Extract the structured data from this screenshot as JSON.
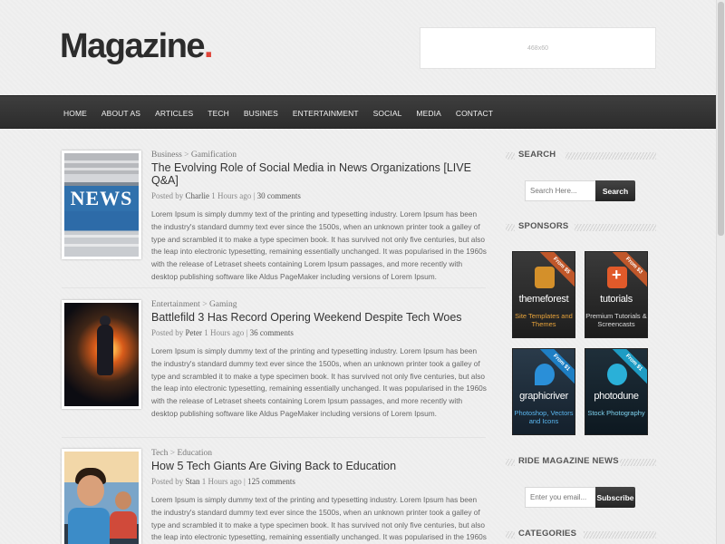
{
  "header": {
    "logo_text": "Magazine",
    "logo_dot": ".",
    "ad_label": "468x60"
  },
  "nav": {
    "items": [
      "HOME",
      "ABOUT AS",
      "ARTICLES",
      "TECH",
      "BUSINES",
      "ENTERTAINMENT",
      "SOCIAL",
      "MEDIA",
      "CONTACT"
    ]
  },
  "posts": [
    {
      "category": "Business",
      "subcategory": "Gamification",
      "title": "The Evolving Role of Social Media in News Organizations [LIVE Q&A]",
      "posted_by": "Posted by",
      "author": "Charlie",
      "time": "1 Hours ago",
      "comments": "30 comments",
      "thumb_icon": "news-newspaper-image",
      "thumb_text": "NEWS",
      "excerpt": "Lorem Ipsum is simply dummy text of the printing and typesetting industry. Lorem Ipsum has been the industry's standard dummy text ever since the 1500s, when an unknown printer took a galley of type and scrambled it to make a type specimen book. It has survived not only five centuries, but also the leap into electronic typesetting, remaining essentially unchanged. It was popularised in the 1960s with the release of Letraset sheets containing Lorem Ipsum passages, and more recently with desktop publishing software like Aldus PageMaker including versions of Lorem Ipsum."
    },
    {
      "category": "Entertainment",
      "subcategory": "Gaming",
      "title": "Battlefild 3 Has Record Opering Weekend Despite Tech Woes",
      "posted_by": "Posted by",
      "author": "Peter",
      "time": "1 Hours ago",
      "comments": "36 comments",
      "thumb_icon": "soldier-game-image",
      "excerpt": "Lorem Ipsum is simply dummy text of the printing and typesetting industry. Lorem Ipsum has been the industry's standard dummy text ever since the 1500s, when an unknown printer took a galley of type and scrambled it to make a type specimen book. It has survived not only five centuries, but also the leap into electronic typesetting, remaining essentially unchanged. It was popularised in the 1960s with the release of Letraset sheets containing Lorem Ipsum passages, and more recently with desktop publishing software like Aldus PageMaker including versions of Lorem Ipsum."
    },
    {
      "category": "Tech",
      "subcategory": "Education",
      "title": "How 5 Tech Giants Are Giving Back to Education",
      "posted_by": "Posted by",
      "author": "Stan",
      "time": "1 Hours ago",
      "comments": "125 comments",
      "thumb_icon": "kids-computer-image",
      "excerpt": "Lorem Ipsum is simply dummy text of the printing and typesetting industry. Lorem Ipsum has been the industry's standard dummy text ever since the 1500s, when an unknown printer took a galley of type and scrambled it to make a type specimen book. It has survived not only five centuries, but also the leap into electronic typesetting, remaining essentially unchanged. It was popularised in the 1960s with the release of Letraset sheets containing Lorem Ipsum passages, and more recently with desktop publishing software like Aldus PageMaker including versions of Lorem Ipsum."
    }
  ],
  "sidebar": {
    "search": {
      "heading": "SEARCH",
      "placeholder": "Search Here...",
      "button": "Search"
    },
    "sponsors": {
      "heading": "SPONSORS",
      "items": [
        {
          "name": "themeforest",
          "sub": "Site Templates and Themes",
          "ribbon": "From $5"
        },
        {
          "name": "tutorials",
          "sub": "Premium Tutorials & Screencasts",
          "ribbon": "From $3"
        },
        {
          "name": "graphicriver",
          "sub": "Photoshop, Vectors and Icons",
          "ribbon": "From $1"
        },
        {
          "name": "photodune",
          "sub": "Stock Photography",
          "ribbon": "From $1"
        }
      ]
    },
    "newsletter": {
      "heading": "RIDE MAGAZINE NEWS",
      "placeholder": "Enter you email...",
      "button": "Subscribe"
    },
    "categories": {
      "heading": "CATEGORIES"
    }
  },
  "colors": {
    "accent": "#e0453a",
    "nav_bg": "#333333",
    "button_bg": "#333333"
  }
}
